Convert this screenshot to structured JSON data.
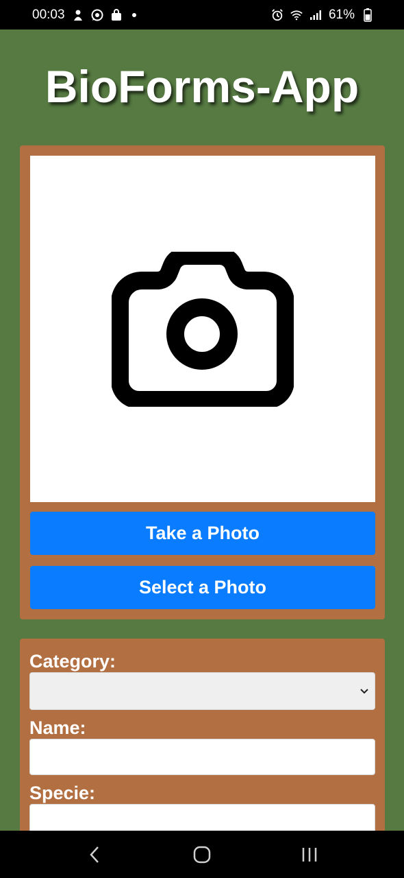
{
  "status_bar": {
    "time": "00:03",
    "battery": "61%",
    "icons": [
      "notification-icon",
      "whatsapp-icon",
      "shopping-bag-icon",
      "dot-icon",
      "alarm-icon",
      "wifi-icon",
      "signal-icon",
      "battery-icon"
    ]
  },
  "app": {
    "title": "BioForms-App"
  },
  "photo_section": {
    "placeholder_icon": "camera-icon",
    "take_photo_label": "Take a Photo",
    "select_photo_label": "Select a Photo"
  },
  "form": {
    "category_label": "Category:",
    "category_value": "",
    "name_label": "Name:",
    "name_value": "",
    "specie_label": "Specie:",
    "specie_value": ""
  },
  "nav_bar": {
    "icons": [
      "back-icon",
      "home-icon",
      "recents-icon"
    ]
  },
  "colors": {
    "background": "#567a42",
    "card": "#b26f42",
    "button": "#0a7cff",
    "button_text": "#ffffff",
    "title_text": "#ffffff"
  }
}
